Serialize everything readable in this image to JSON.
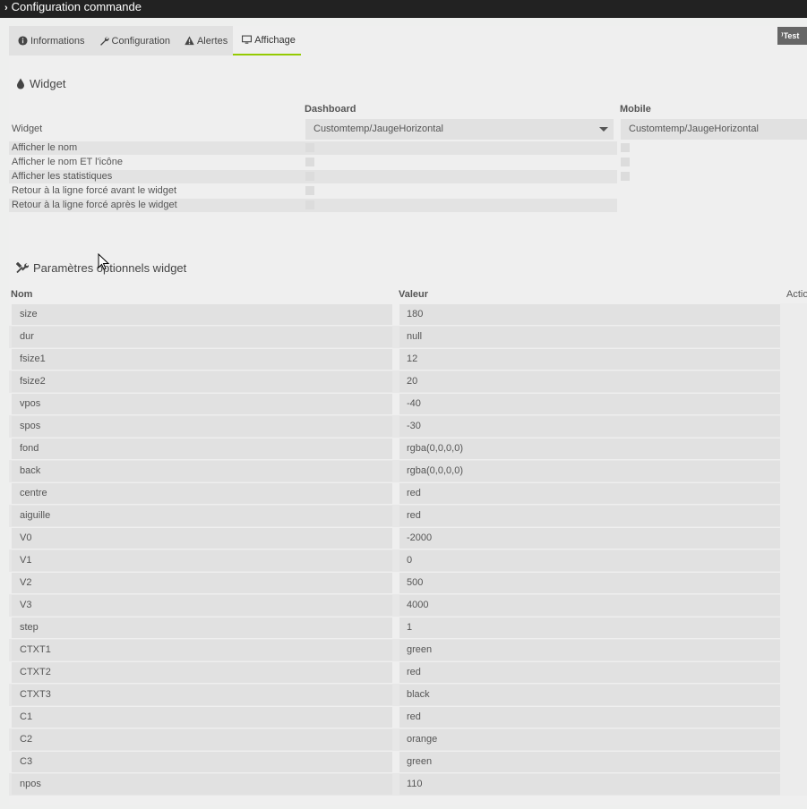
{
  "window": {
    "title": "Configuration commande"
  },
  "tabs": [
    {
      "label": "Informations",
      "icon": "info-circle-icon"
    },
    {
      "label": "Configuration",
      "icon": "wrench-icon"
    },
    {
      "label": "Alertes",
      "icon": "warning-triangle-icon"
    },
    {
      "label": "Affichage",
      "icon": "monitor-icon",
      "active": true
    }
  ],
  "test_button": {
    "label": "Test",
    "icon": "rss-icon"
  },
  "widget_section": {
    "title": "Widget",
    "icon": "droplet-icon",
    "col_dashboard": "Dashboard",
    "col_mobile": "Mobile",
    "widget_label": "Widget",
    "dashboard_select": "Customtemp/JaugeHorizontal",
    "mobile_select": "Customtemp/JaugeHorizontal",
    "rows": [
      {
        "label": "Afficher le nom"
      },
      {
        "label": "Afficher le nom ET l'icône"
      },
      {
        "label": "Afficher les statistiques"
      },
      {
        "label": "Retour à la ligne forcé avant le widget"
      },
      {
        "label": "Retour à la ligne forcé après le widget"
      }
    ]
  },
  "params_section": {
    "title": "Paramètres optionnels widget",
    "icon": "tools-icon",
    "col_name": "Nom",
    "col_value": "Valeur",
    "col_action": "Action",
    "rows": [
      {
        "name": "size",
        "value": "180"
      },
      {
        "name": "dur",
        "value": "null"
      },
      {
        "name": "fsize1",
        "value": "12"
      },
      {
        "name": "fsize2",
        "value": "20"
      },
      {
        "name": "vpos",
        "value": "-40"
      },
      {
        "name": "spos",
        "value": "-30"
      },
      {
        "name": "fond",
        "value": "rgba(0,0,0,0)"
      },
      {
        "name": "back",
        "value": "rgba(0,0,0,0)"
      },
      {
        "name": "centre",
        "value": "red"
      },
      {
        "name": "aiguille",
        "value": "red"
      },
      {
        "name": "V0",
        "value": "-2000"
      },
      {
        "name": "V1",
        "value": "0"
      },
      {
        "name": "V2",
        "value": "500"
      },
      {
        "name": "V3",
        "value": "4000"
      },
      {
        "name": "step",
        "value": "1"
      },
      {
        "name": "CTXT1",
        "value": "green"
      },
      {
        "name": "CTXT2",
        "value": "red"
      },
      {
        "name": "CTXT3",
        "value": "black"
      },
      {
        "name": "C1",
        "value": "red"
      },
      {
        "name": "C2",
        "value": "orange"
      },
      {
        "name": "C3",
        "value": "green"
      },
      {
        "name": "npos",
        "value": "110"
      }
    ]
  },
  "colors": {
    "accent": "#94ca02",
    "titlebar": "#222222"
  }
}
